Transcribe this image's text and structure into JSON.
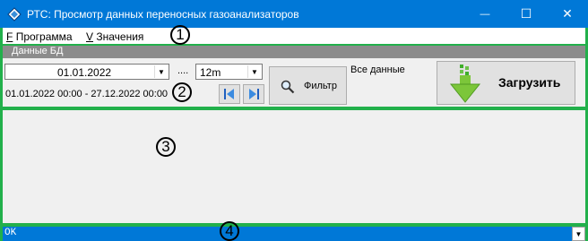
{
  "window": {
    "title": "РТС: Просмотр данных переносных газоанализаторов",
    "minimize_glyph": "—",
    "maximize_glyph": "☐",
    "close_glyph": "✕"
  },
  "menu": {
    "items": [
      {
        "hotkey": "F",
        "label": "Программа"
      },
      {
        "hotkey": "V",
        "label": "Значения"
      }
    ]
  },
  "group": {
    "title": "Данные БД"
  },
  "toolbar": {
    "date_value": "01.01.2022",
    "dots": "....",
    "interval_value": "12m",
    "range_text": "01.01.2022 00:00 - 27.12.2022 00:00",
    "filter_label": "Фильтр",
    "all_data_label": "Все данные",
    "load_label": "Загрузить"
  },
  "status": {
    "text": "OK"
  },
  "annotations": {
    "n1": "1",
    "n2": "2",
    "n3": "3",
    "n4": "4"
  },
  "colors": {
    "titlebar": "#0078d7",
    "highlight_border": "#22b04b",
    "status_bar": "#0078d7",
    "load_arrow": "#7cc63a"
  },
  "icons": {
    "app": "diamond-app-icon",
    "filter": "magnifier-icon",
    "load": "green-down-arrow-icon",
    "prev": "skip-previous-icon",
    "next": "skip-next-icon"
  }
}
